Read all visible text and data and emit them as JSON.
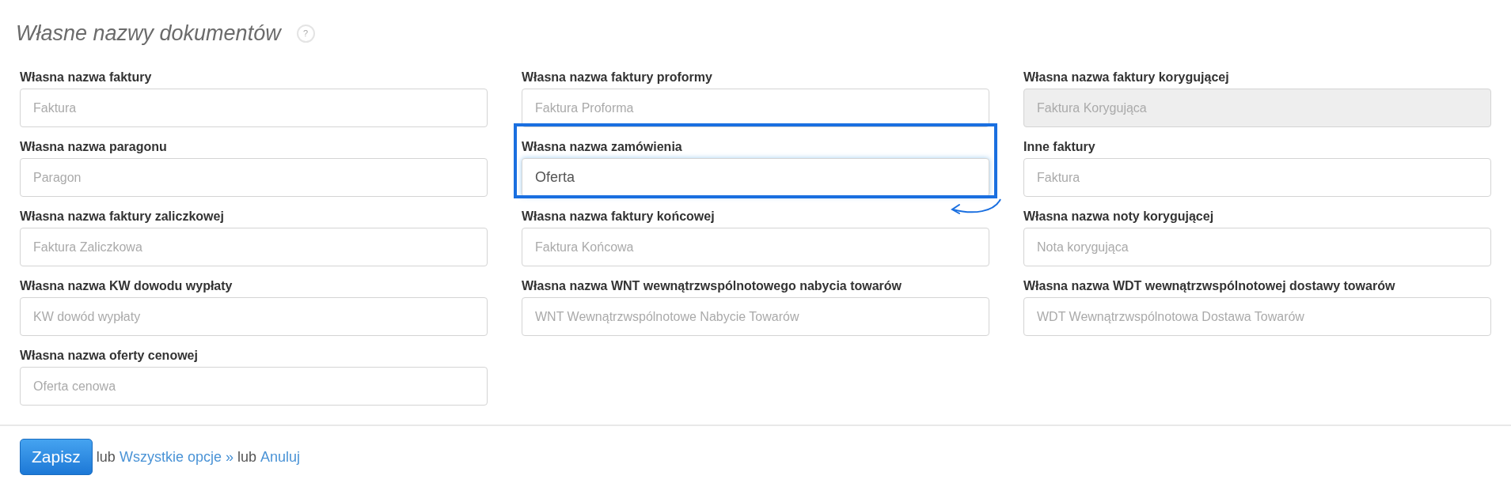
{
  "section": {
    "title": "Własne nazwy dokumentów",
    "help": "?"
  },
  "fields": [
    {
      "label": "Własna nazwa faktury",
      "placeholder": "Faktura",
      "disabled": false,
      "highlighted": false
    },
    {
      "label": "Własna nazwa faktury proformy",
      "placeholder": "Faktura Proforma",
      "disabled": false,
      "highlighted": false
    },
    {
      "label": "Własna nazwa faktury korygującej",
      "placeholder": "Faktura Korygująca",
      "disabled": true,
      "highlighted": false
    },
    {
      "label": "Własna nazwa paragonu",
      "placeholder": "Paragon",
      "disabled": false,
      "highlighted": false
    },
    {
      "label": "Własna nazwa zamówienia",
      "value": "Oferta",
      "disabled": false,
      "highlighted": true
    },
    {
      "label": "Inne faktury",
      "placeholder": "Faktura",
      "disabled": false,
      "highlighted": false
    },
    {
      "label": "Własna nazwa faktury zaliczkowej",
      "placeholder": "Faktura Zaliczkowa",
      "disabled": false,
      "highlighted": false
    },
    {
      "label": "Własna nazwa faktury końcowej",
      "placeholder": "Faktura Końcowa",
      "disabled": false,
      "highlighted": false
    },
    {
      "label": "Własna nazwa noty korygującej",
      "placeholder": "Nota korygująca",
      "disabled": false,
      "highlighted": false
    },
    {
      "label": "Własna nazwa KW dowodu wypłaty",
      "placeholder": "KW dowód wypłaty",
      "disabled": false,
      "highlighted": false
    },
    {
      "label": "Własna nazwa WNT wewnątrzwspólnotowego nabycia towarów",
      "placeholder": "WNT Wewnątrzwspólnotowe Nabycie Towarów",
      "disabled": false,
      "highlighted": false
    },
    {
      "label": "Własna nazwa WDT wewnątrzwspólnotowej dostawy towarów",
      "placeholder": "WDT Wewnątrzwspólnotowa Dostawa Towarów",
      "disabled": false,
      "highlighted": false
    },
    {
      "label": "Własna nazwa oferty cenowej",
      "placeholder": "Oferta cenowa",
      "disabled": false,
      "highlighted": false
    }
  ],
  "footer": {
    "save": "Zapisz",
    "or_1": "lub",
    "all_options": "Wszystkie opcje »",
    "or_2": "lub",
    "cancel": "Anuluj"
  }
}
